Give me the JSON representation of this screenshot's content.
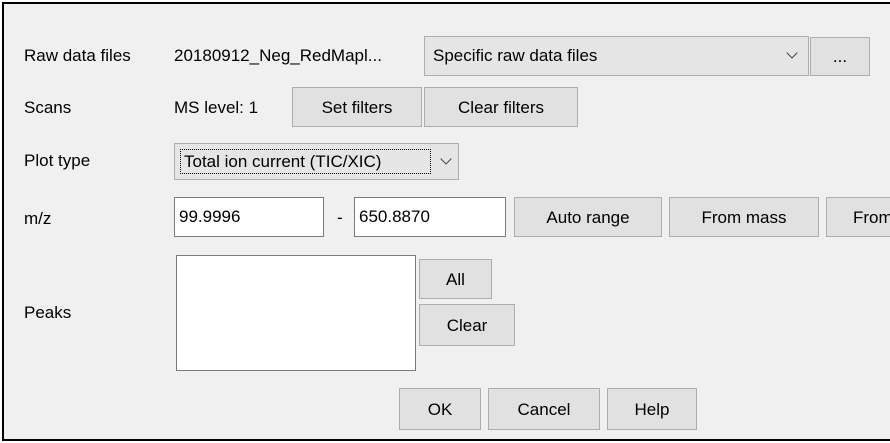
{
  "raw_data_files": {
    "label": "Raw data files",
    "value": "20180912_Neg_RedMapl...",
    "selector": "Specific raw data files",
    "browse_label": "..."
  },
  "scans": {
    "label": "Scans",
    "value": "MS level: 1",
    "set_filters_label": "Set filters",
    "clear_filters_label": "Clear filters"
  },
  "plot_type": {
    "label": "Plot type",
    "selected": "Total ion current (TIC/XIC)"
  },
  "mz": {
    "label": "m/z",
    "min_value": "99.9996",
    "separator": "-",
    "max_value": "650.8870",
    "auto_range_label": "Auto range",
    "from_mass_label": "From mass",
    "from_truncated_label": "From"
  },
  "peaks": {
    "label": "Peaks",
    "all_label": "All",
    "clear_label": "Clear"
  },
  "footer": {
    "ok_label": "OK",
    "cancel_label": "Cancel",
    "help_label": "Help"
  }
}
